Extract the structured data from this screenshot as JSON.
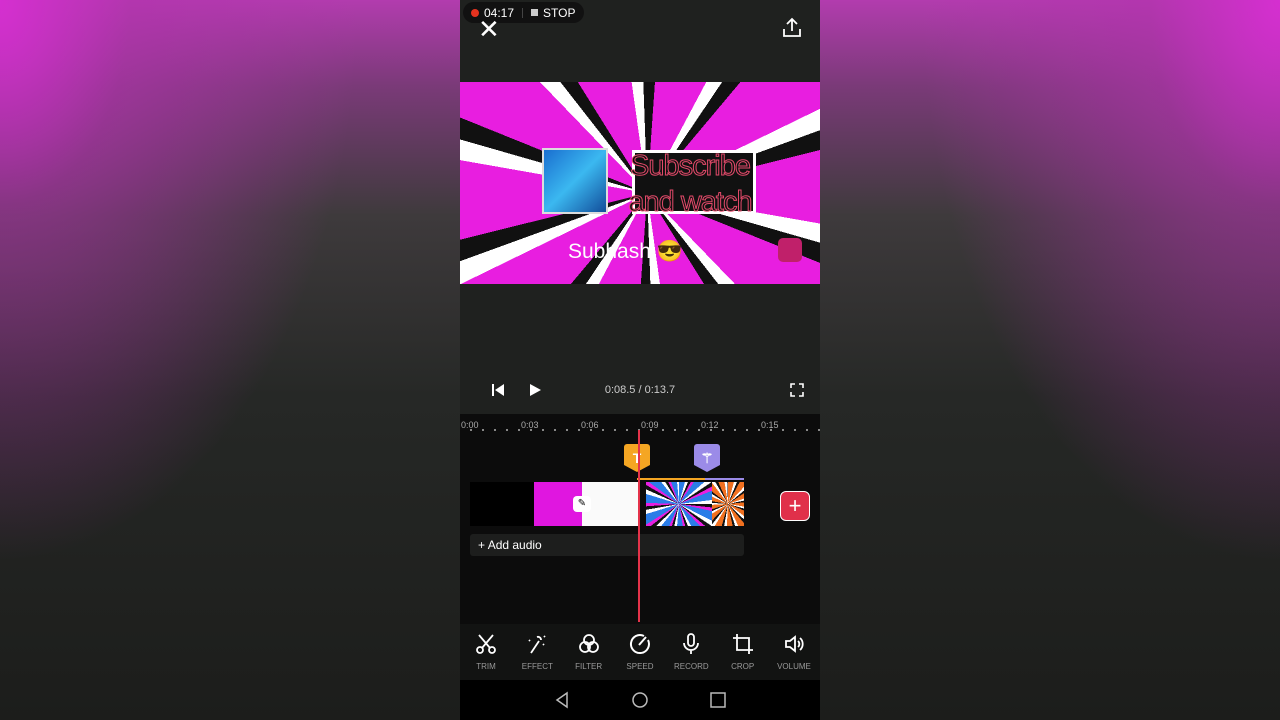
{
  "recording": {
    "time": "04:17",
    "stop_label": "STOP"
  },
  "preview": {
    "headline": "Subscribe and watch",
    "author": "Subhash 😎"
  },
  "player": {
    "time": "0:08.5 / 0:13.7"
  },
  "ruler": [
    "0:00",
    "0:03",
    "0:06",
    "0:09",
    "0:12",
    "0:15"
  ],
  "timeline": {
    "text_marker": "T",
    "add_audio": "Add audio",
    "add_clip": "+"
  },
  "tools": [
    "TRIM",
    "EFFECT",
    "FILTER",
    "SPEED",
    "RECORD",
    "CROP",
    "VOLUME"
  ],
  "colors": {
    "accent": "#e0304a",
    "text_marker": "#f5a623",
    "effect_marker": "#9b8be8"
  }
}
